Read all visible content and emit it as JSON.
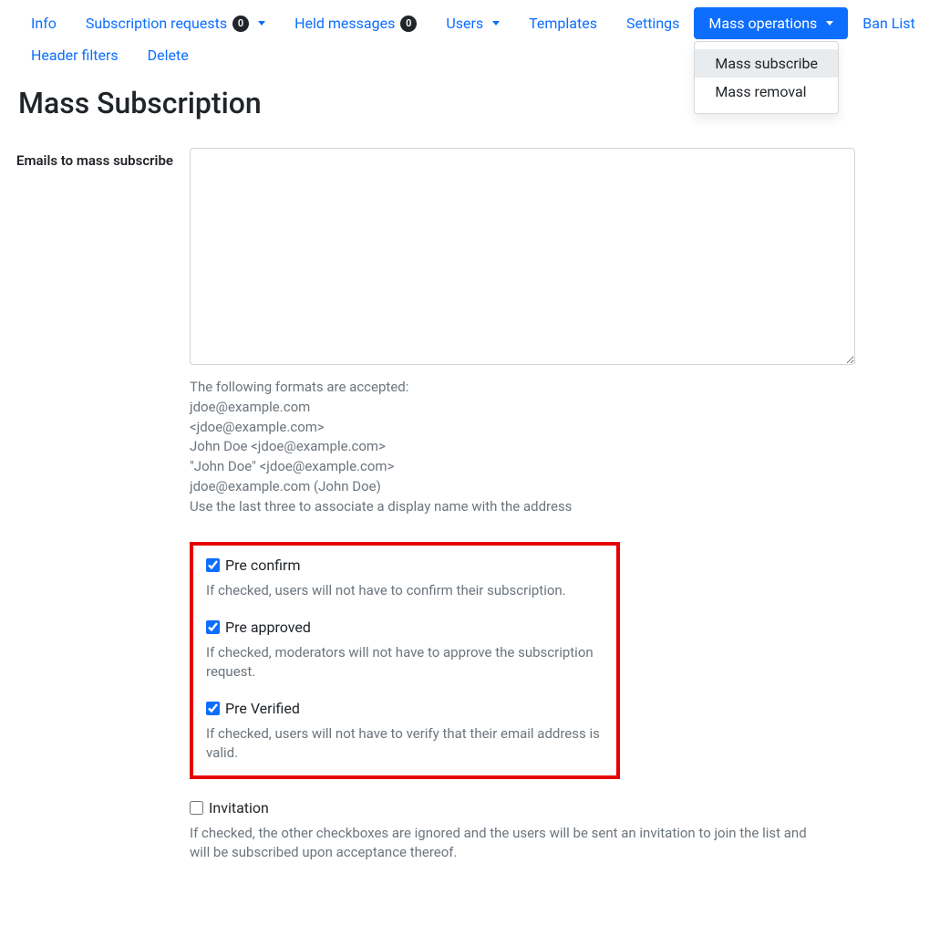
{
  "nav": {
    "info": "Info",
    "subscription_requests": {
      "label": "Subscription requests",
      "badge": "0"
    },
    "held_messages": {
      "label": "Held messages",
      "badge": "0"
    },
    "users": "Users",
    "templates": "Templates",
    "settings": "Settings",
    "mass_operations": {
      "label": "Mass operations",
      "items": {
        "subscribe": "Mass subscribe",
        "removal": "Mass removal"
      }
    },
    "ban_list": "Ban List",
    "header_filters": "Header filters",
    "delete": "Delete"
  },
  "page": {
    "title": "Mass Subscription"
  },
  "form": {
    "emails": {
      "label": "Emails to mass subscribe",
      "value": "",
      "help_intro": "The following formats are accepted:",
      "help_lines": [
        "jdoe@example.com",
        "<jdoe@example.com>",
        "John Doe <jdoe@example.com>",
        "\"John Doe\" <jdoe@example.com>",
        "jdoe@example.com (John Doe)"
      ],
      "help_outro": "Use the last three to associate a display name with the address"
    },
    "pre_confirm": {
      "label": "Pre confirm",
      "checked": true,
      "help": "If checked, users will not have to confirm their subscription."
    },
    "pre_approved": {
      "label": "Pre approved",
      "checked": true,
      "help": "If checked, moderators will not have to approve the subscription request."
    },
    "pre_verified": {
      "label": "Pre Verified",
      "checked": true,
      "help": "If checked, users will not have to verify that their email address is valid."
    },
    "invitation": {
      "label": "Invitation",
      "checked": false,
      "help": "If checked, the other checkboxes are ignored and the users will be sent an invitation to join the list and will be subscribed upon acceptance thereof."
    }
  }
}
